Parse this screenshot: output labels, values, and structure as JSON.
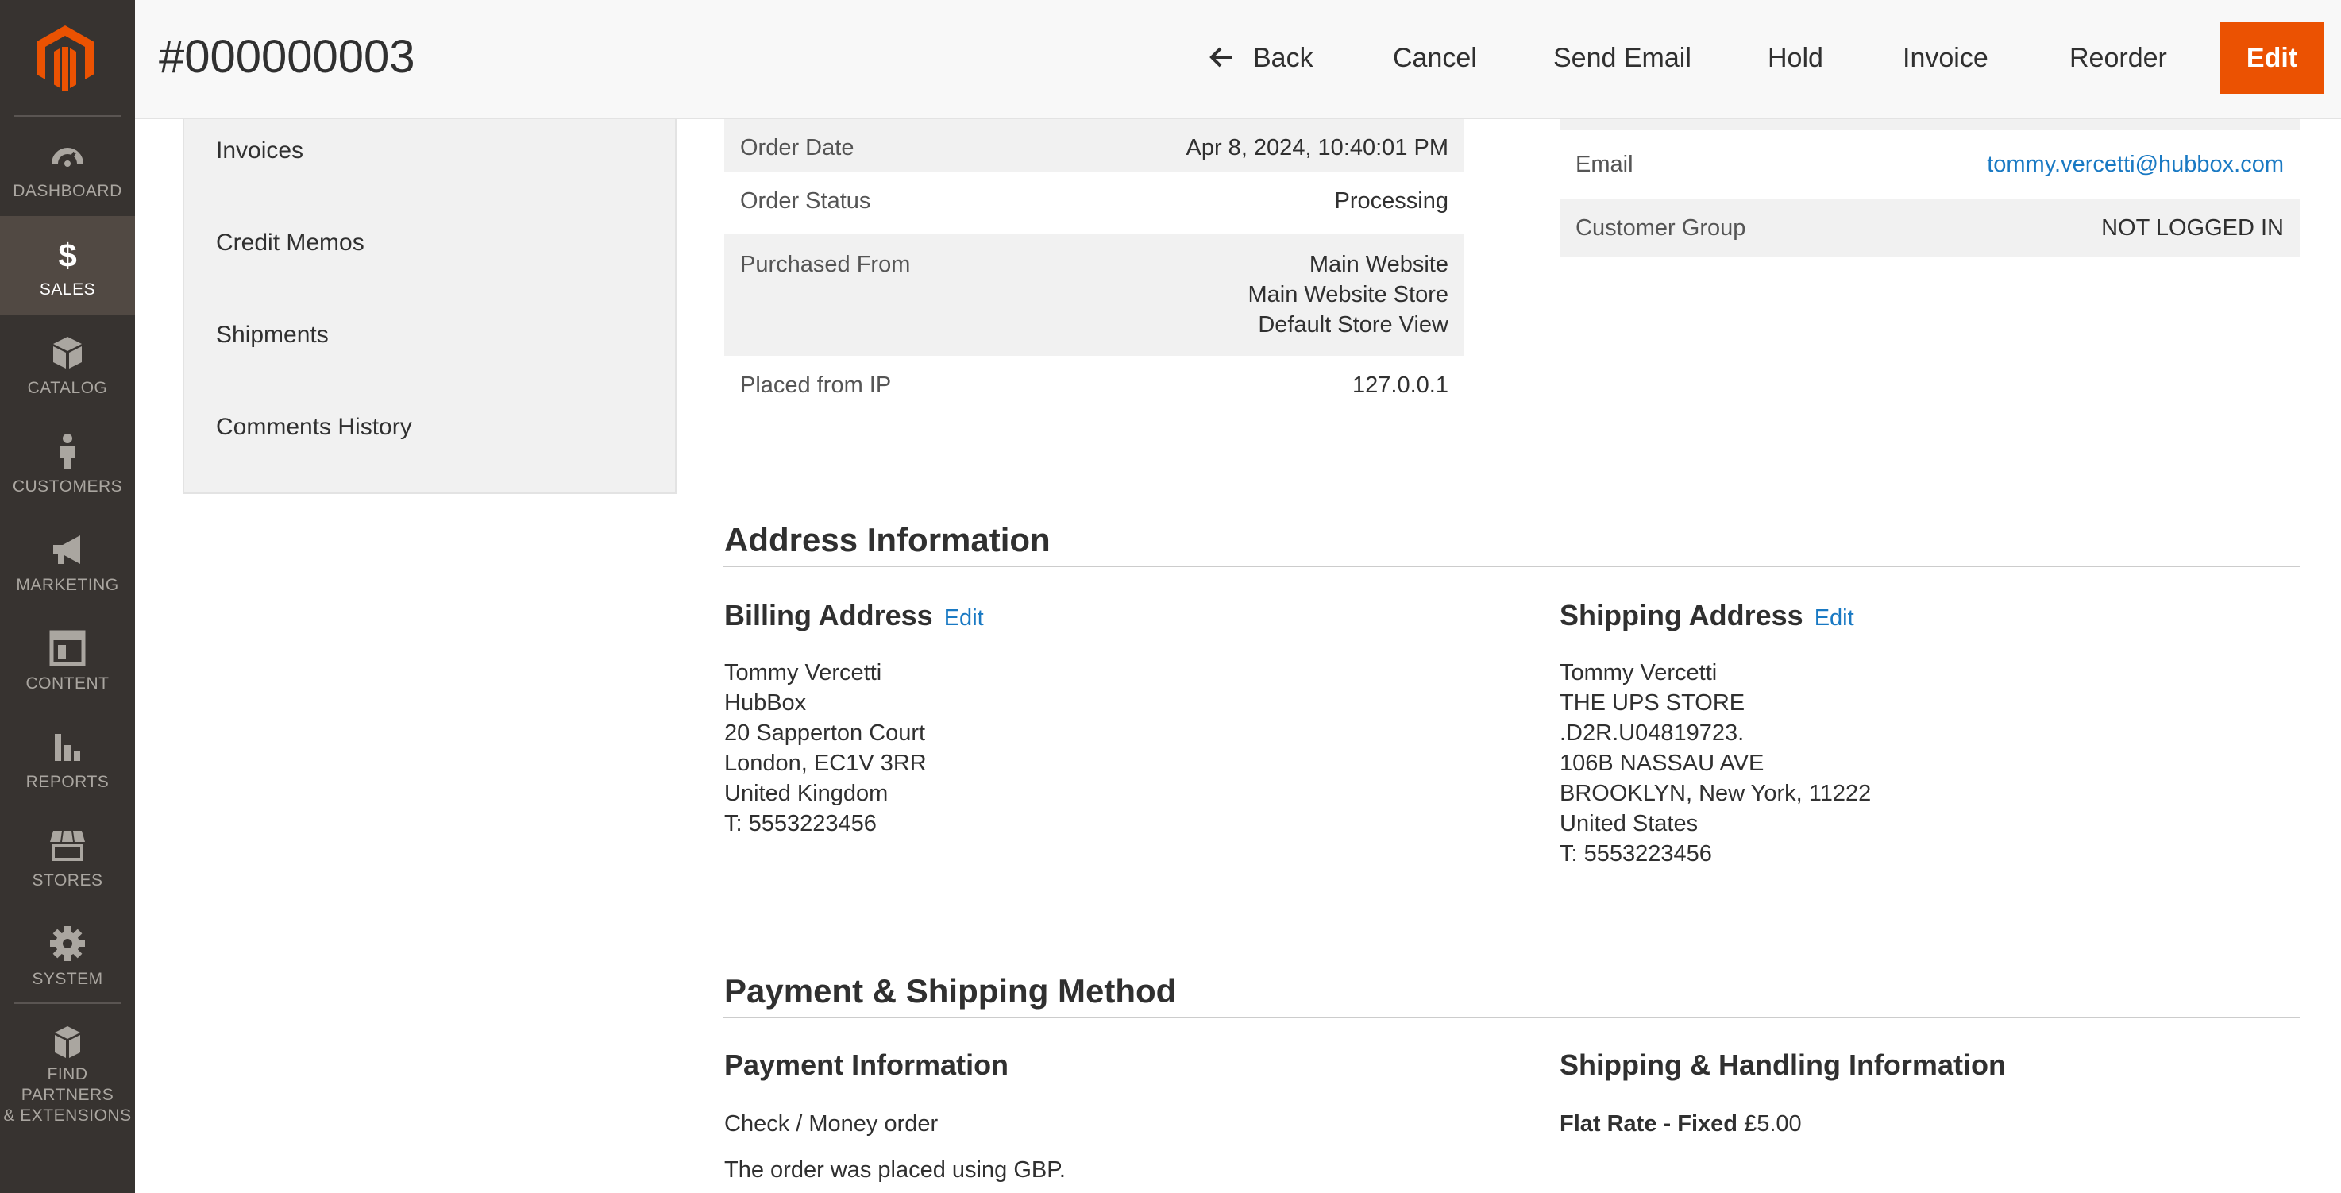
{
  "menu": {
    "items": [
      {
        "label": "DASHBOARD",
        "icon": "dashboard-icon"
      },
      {
        "label": "SALES",
        "icon": "dollar-icon",
        "active": true
      },
      {
        "label": "CATALOG",
        "icon": "cube-icon"
      },
      {
        "label": "CUSTOMERS",
        "icon": "person-icon"
      },
      {
        "label": "MARKETING",
        "icon": "megaphone-icon"
      },
      {
        "label": "CONTENT",
        "icon": "layout-icon"
      },
      {
        "label": "REPORTS",
        "icon": "bar-chart-icon"
      },
      {
        "label": "STORES",
        "icon": "storefront-icon"
      },
      {
        "label": "SYSTEM",
        "icon": "gear-icon"
      }
    ],
    "partners_line1": "FIND PARTNERS",
    "partners_line2": "& EXTENSIONS",
    "logo_icon": "magento-logo"
  },
  "header": {
    "title": "#000000003",
    "back": "Back",
    "cancel": "Cancel",
    "send_email": "Send Email",
    "hold": "Hold",
    "invoice": "Invoice",
    "reorder": "Reorder",
    "edit": "Edit"
  },
  "side_tabs": [
    "Invoices",
    "Credit Memos",
    "Shipments",
    "Comments History"
  ],
  "order_info": {
    "order_date_label": "Order Date",
    "order_date": "Apr 8, 2024, 10:40:01 PM",
    "status_label": "Order Status",
    "status": "Processing",
    "purchased_label": "Purchased From",
    "purchased_1": "Main Website",
    "purchased_2": "Main Website Store",
    "purchased_3": "Default Store View",
    "ip_label": "Placed from IP",
    "ip": "127.0.0.1"
  },
  "account_info": {
    "email_label": "Email",
    "email": "tommy.vercetti@hubbox.com",
    "group_label": "Customer Group",
    "group": "NOT LOGGED IN"
  },
  "address_section": {
    "title": "Address Information",
    "billing_title": "Billing Address",
    "billing_edit": "Edit",
    "billing_lines": [
      "Tommy Vercetti",
      "HubBox",
      "20 Sapperton Court",
      "London, EC1V 3RR",
      "United Kingdom",
      "T: 5553223456"
    ],
    "shipping_title": "Shipping Address",
    "shipping_edit": "Edit",
    "shipping_lines": [
      "Tommy Vercetti",
      "THE UPS STORE",
      ".D2R.U04819723.",
      "106B NASSAU AVE",
      "BROOKLYN, New York, 11222",
      "United States",
      "T: 5553223456"
    ]
  },
  "payment_section": {
    "title": "Payment & Shipping Method",
    "payment_title": "Payment Information",
    "payment_method": "Check / Money order",
    "payment_note": "The order was placed using GBP.",
    "shipping_title": "Shipping & Handling Information",
    "shipping_method": "Flat Rate - Fixed",
    "shipping_price": "£5.00"
  },
  "colors": {
    "accent": "#eb5202",
    "link": "#1979c3",
    "menu_bg": "#373330",
    "menu_active": "#514943"
  }
}
